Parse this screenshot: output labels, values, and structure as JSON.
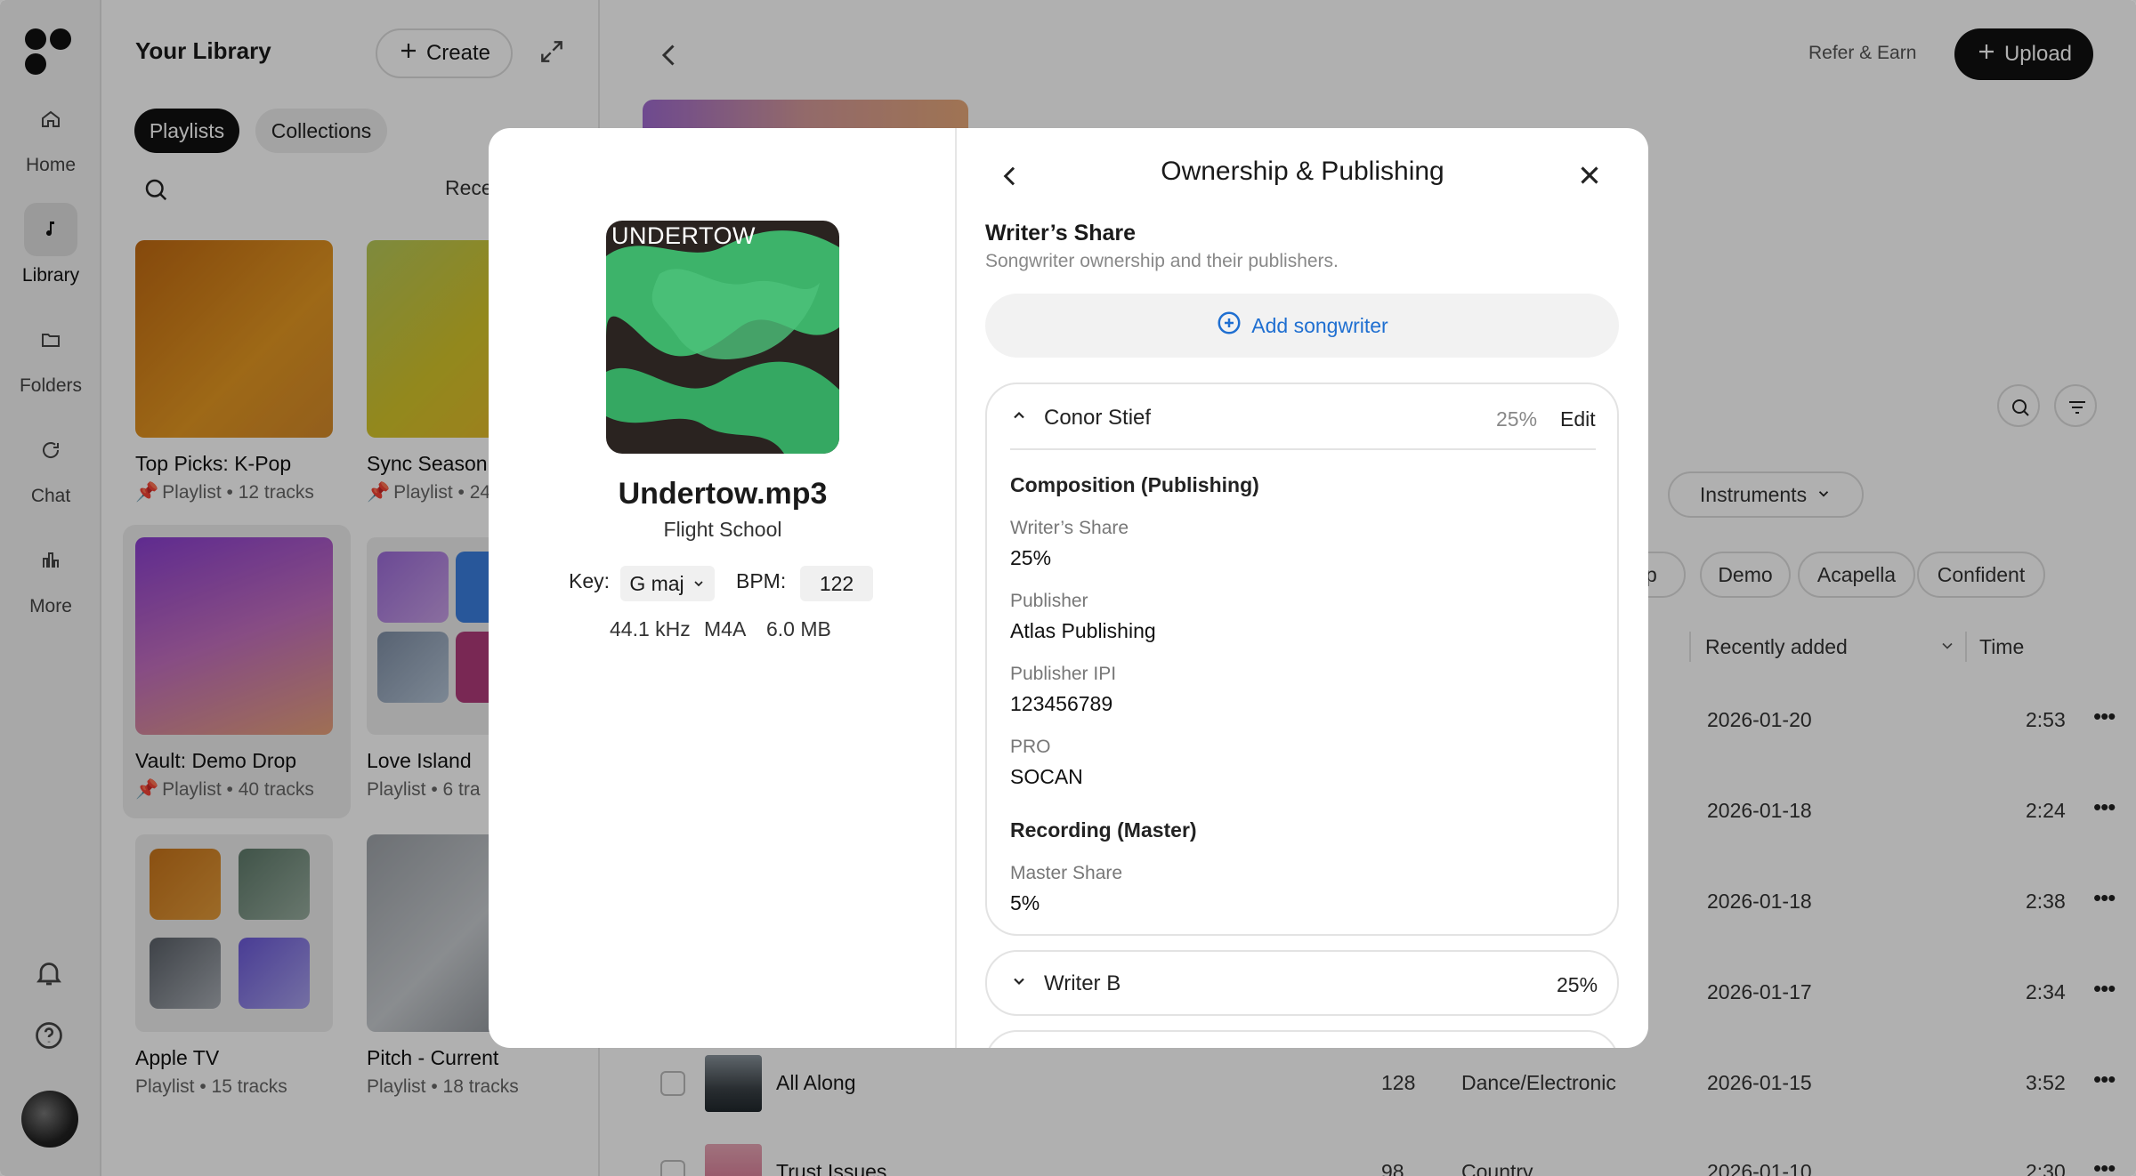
{
  "rail": {
    "items": [
      {
        "label": "Home",
        "icon": "home-icon"
      },
      {
        "label": "Library",
        "icon": "music-note-icon",
        "active": true
      },
      {
        "label": "Folders",
        "icon": "folder-icon"
      },
      {
        "label": "Chat",
        "icon": "chat-icon"
      },
      {
        "label": "More",
        "icon": "bar-chart-icon"
      }
    ]
  },
  "library": {
    "title": "Your Library",
    "create_label": "Create",
    "tabs": [
      "Playlists",
      "Collections"
    ],
    "recents_label": "Rece",
    "cards": [
      {
        "title": "Top Picks: K-Pop",
        "sub": "Playlist • 12 tracks",
        "pinned": true
      },
      {
        "title": "Sync Season",
        "sub": "Playlist • 24",
        "pinned": true
      },
      {
        "title": "Vault: Demo Drop",
        "sub": "Playlist • 40 tracks",
        "pinned": true
      },
      {
        "title": "Love Island",
        "sub": "Playlist • 6 tra",
        "pinned": false
      },
      {
        "title": "Apple TV",
        "sub": "Playlist • 15 tracks",
        "pinned": false
      },
      {
        "title": "Pitch - Current",
        "sub": "Playlist • 18 tracks",
        "pinned": false
      }
    ]
  },
  "main": {
    "refer_label": "Refer & Earn",
    "upload_label": "Upload",
    "filter_instruments": "Instruments",
    "tags": [
      "op",
      "Demo",
      "Acapella",
      "Confident"
    ],
    "col_recent": "Recently added",
    "col_time": "Time",
    "rows": [
      {
        "name": "",
        "bpm": "",
        "genre": "",
        "date": "2026-01-20",
        "time": "2:53"
      },
      {
        "name": "",
        "bpm": "",
        "genre": "",
        "date": "2026-01-18",
        "time": "2:24"
      },
      {
        "name": "",
        "bpm": "",
        "genre": "",
        "date": "2026-01-18",
        "time": "2:38"
      },
      {
        "name": "",
        "bpm": "",
        "genre": "",
        "date": "2026-01-17",
        "time": "2:34"
      },
      {
        "name": "All Along",
        "bpm": "128",
        "genre": "Dance/Electronic",
        "date": "2026-01-15",
        "time": "3:52"
      },
      {
        "name": "Trust Issues",
        "bpm": "98",
        "genre": "Country",
        "date": "2026-01-10",
        "time": "2:30"
      }
    ]
  },
  "track": {
    "cover_text": "UNDERTOW",
    "filename": "Undertow.mp3",
    "artist": "Flight School",
    "key_label": "Key:",
    "key_value": "G maj",
    "bpm_label": "BPM:",
    "bpm_value": "122",
    "sample_rate": "44.1 kHz",
    "format": "M4A",
    "size": "6.0 MB"
  },
  "ownership": {
    "title": "Ownership & Publishing",
    "writers_share_title": "Writer’s Share",
    "writers_share_sub": "Songwriter ownership and their publishers.",
    "add_songwriter": "Add songwriter",
    "writers": [
      {
        "name": "Conor Stief",
        "pct": "25%",
        "edit": "Edit",
        "composition_title": "Composition (Publishing)",
        "writers_share_label": "Writer’s Share",
        "writers_share_value": "25%",
        "publisher_label": "Publisher",
        "publisher_value": "Atlas Publishing",
        "ipi_label": "Publisher IPI",
        "ipi_value": "123456789",
        "pro_label": "PRO",
        "pro_value": "SOCAN",
        "recording_title": "Recording (Master)",
        "master_label": "Master Share",
        "master_value": "5%"
      },
      {
        "name": "Writer B",
        "pct": "25%"
      }
    ]
  }
}
